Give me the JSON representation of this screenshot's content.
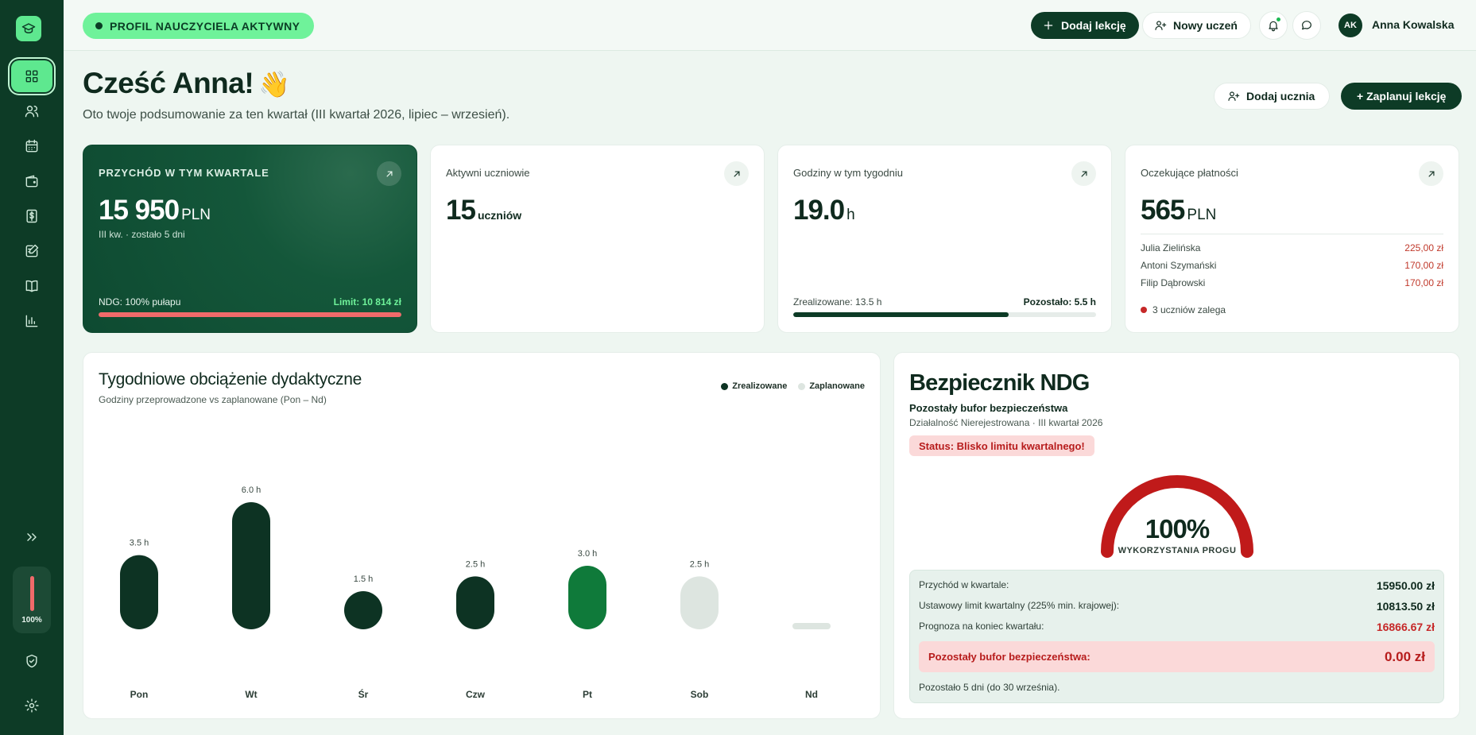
{
  "topbar": {
    "profile_badge": "PROFIL NAUCZYCIELA AKTYWNY",
    "add_lesson": "Dodaj lekcję",
    "new_student": "Nowy uczeń",
    "user_initials": "AK",
    "user_name": "Anna Kowalska"
  },
  "sidebar": {
    "items": [
      {
        "icon": "dashboard-icon",
        "active": true
      },
      {
        "icon": "users-icon",
        "active": false
      },
      {
        "icon": "calendar-icon",
        "active": false
      },
      {
        "icon": "wallet-icon",
        "active": false
      },
      {
        "icon": "dollar-icon",
        "active": false
      },
      {
        "icon": "edit-note-icon",
        "active": false
      },
      {
        "icon": "book-icon",
        "active": false
      },
      {
        "icon": "bar-chart-icon",
        "active": false
      }
    ],
    "gauge_label": "100%"
  },
  "header": {
    "greeting": "Cześć Anna!",
    "wave": "👋",
    "subtitle": "Oto twoje podsumowanie za ten kwartał (III kwartał 2026, lipiec – wrzesień).",
    "add_student": "Dodaj ucznia",
    "schedule_lesson": "+ Zaplanuj lekcję"
  },
  "stats": {
    "revenue": {
      "title": "PRZYCHÓD W TYM KWARTALE",
      "value": "15 950",
      "unit": "PLN",
      "sub": "III kw. · zostało 5 dni",
      "foot_left": "NDG: 100% pułapu",
      "foot_right": "Limit: 10 814 zł",
      "progress": 1.0
    },
    "students": {
      "title": "Aktywni uczniowie",
      "value": "15",
      "unit": "uczniów"
    },
    "hours": {
      "title": "Godziny w tym tygodniu",
      "value": "19.0",
      "unit": "h",
      "foot_left": "Zrealizowane: 13.5 h",
      "foot_right": "Pozostało: 5.5 h",
      "progress": 0.71
    },
    "payments": {
      "title": "Oczekujące płatności",
      "value": "565",
      "unit": "PLN",
      "rows": [
        {
          "name": "Julia Zielińska",
          "amount": "225,00 zł"
        },
        {
          "name": "Antoni Szymański",
          "amount": "170,00 zł"
        },
        {
          "name": "Filip Dąbrowski",
          "amount": "170,00 zł"
        }
      ],
      "note": "3 uczniów zalega"
    }
  },
  "chart": {
    "title": "Tygodniowe obciążenie dydaktyczne",
    "subtitle": "Godziny przeprowadzone vs zaplanowane (Pon – Nd)",
    "legend_done": "Zrealizowane",
    "legend_planned": "Zaplanowane"
  },
  "chart_data": {
    "type": "bar",
    "title": "Tygodniowe obciążenie dydaktyczne",
    "categories": [
      "Pon",
      "Wt",
      "Śr",
      "Czw",
      "Pt",
      "Sob",
      "Nd"
    ],
    "values": [
      3.5,
      6.0,
      1.5,
      2.5,
      3.0,
      2.5,
      0
    ],
    "labels": [
      "3.5 h",
      "6.0 h",
      "1.5 h",
      "2.5 h",
      "3.0 h",
      "2.5 h",
      ""
    ],
    "status": [
      "Zrealizowane",
      "Zrealizowane",
      "Zrealizowane",
      "Zrealizowane",
      "today",
      "Zaplanowane",
      "Zaplanowane"
    ],
    "ylim": [
      0,
      6
    ],
    "colors": {
      "done": "#0d3323",
      "today": "#0f7a3a",
      "planned": "#dde5e0"
    }
  },
  "safety": {
    "title": "Bezpiecznik NDG",
    "sub1": "Pozostały bufor bezpieczeństwa",
    "sub2": "Działalność Nierejestrowana · III kwartał 2026",
    "status": "Status: Blisko limitu kwartalnego!",
    "gauge_pct": "100%",
    "gauge_value": 1.0,
    "gauge_label": "WYKORZYSTANIA PROGU",
    "rows": [
      {
        "label": "Przychód w kwartale:",
        "value": "15950.00 zł",
        "red": false
      },
      {
        "label": "Ustawowy limit kwartalny (225% min. krajowej):",
        "value": "10813.50 zł",
        "red": false
      },
      {
        "label": "Prognoza na koniec kwartału:",
        "value": "16866.67 zł",
        "red": true
      }
    ],
    "buffer_label": "Pozostały bufor bezpieczeństwa:",
    "buffer_value": "0.00 zł",
    "foot": "Pozostało 5 dni (do 30 września)."
  }
}
